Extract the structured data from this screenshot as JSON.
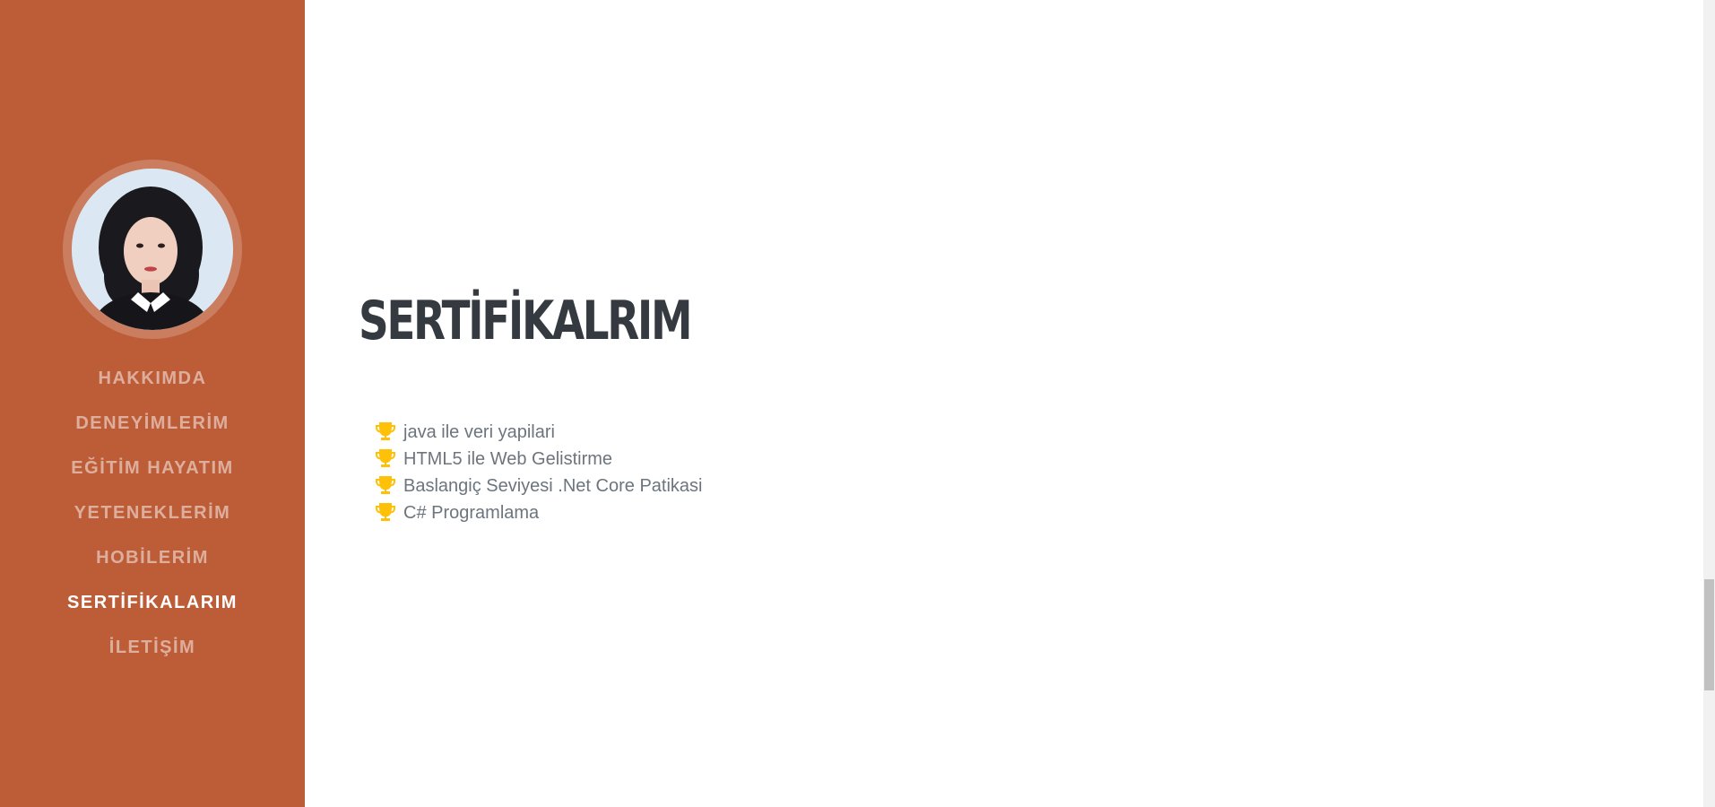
{
  "sidebar": {
    "avatar_alt": "profile photo",
    "nav": [
      {
        "label": "HAKKIMDA",
        "active": false
      },
      {
        "label": "DENEYİMLERİM",
        "active": false
      },
      {
        "label": "EĞİTİM HAYATIM",
        "active": false
      },
      {
        "label": "YETENEKLERİM",
        "active": false
      },
      {
        "label": "HOBİLERİM",
        "active": false
      },
      {
        "label": "SERTİFİKALARIM",
        "active": true
      },
      {
        "label": "İLETİŞİM",
        "active": false
      }
    ]
  },
  "main": {
    "title": "SERTİFİKALRIM",
    "certificates": [
      {
        "icon": "trophy-icon",
        "text": "java ile veri yapilari"
      },
      {
        "icon": "trophy-icon",
        "text": "HTML5 ile Web Gelistirme"
      },
      {
        "icon": "trophy-icon",
        "text": "Baslangiç Seviyesi .Net Core Patikasi"
      },
      {
        "icon": "trophy-icon",
        "text": "C# Programlama"
      }
    ]
  },
  "colors": {
    "sidebar_bg": "#bd5d38",
    "title": "#343a40",
    "text": "#6c757d",
    "trophy": "#ffc107"
  }
}
